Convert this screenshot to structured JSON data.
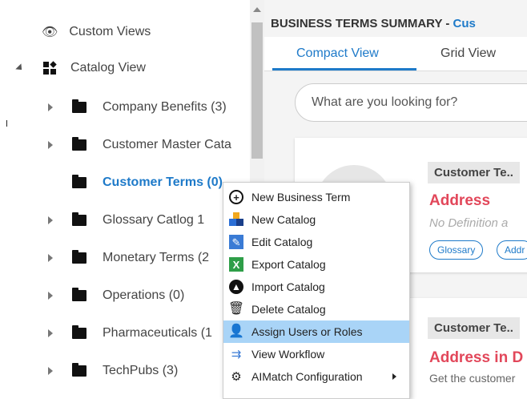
{
  "tree": {
    "custom_views": "Custom Views",
    "catalog_view": "Catalog View",
    "items": [
      {
        "label": "Company Benefits (3)",
        "expandable": true
      },
      {
        "label": "Customer Master Cata",
        "expandable": true
      },
      {
        "label": "Customer Terms (0)",
        "expandable": false,
        "selected": true
      },
      {
        "label": "Glossary Catlog 1",
        "expandable": true
      },
      {
        "label": "Monetary Terms (2",
        "expandable": true
      },
      {
        "label": "Operations (0)",
        "expandable": true
      },
      {
        "label": "Pharmaceuticals (1",
        "expandable": true
      },
      {
        "label": "TechPubs (3)",
        "expandable": true
      }
    ]
  },
  "summary": {
    "title_prefix": "BUSINESS TERMS SUMMARY - ",
    "title_highlight": "Cus",
    "tabs": [
      "Compact View",
      "Grid View"
    ],
    "search_placeholder": "What are you looking for?"
  },
  "cards": [
    {
      "tag": "Customer Te..",
      "title": "Address",
      "desc": "No Definition a",
      "pills": [
        "Glossary",
        "Addr"
      ]
    },
    {
      "tag": "Customer Te..",
      "title": "Address in D",
      "desc": "Get the customer"
    }
  ],
  "context_menu": {
    "items": [
      {
        "label": "New Business Term",
        "icon": "plus-circle-icon"
      },
      {
        "label": "New Catalog",
        "icon": "new-catalog-icon"
      },
      {
        "label": "Edit Catalog",
        "icon": "edit-icon"
      },
      {
        "label": "Export Catalog",
        "icon": "export-icon"
      },
      {
        "label": "Import Catalog",
        "icon": "import-icon"
      },
      {
        "label": "Delete Catalog",
        "icon": "trash-icon"
      },
      {
        "label": "Assign Users or Roles",
        "icon": "user-assign-icon",
        "hover": true
      },
      {
        "label": "View Workflow",
        "icon": "workflow-icon"
      },
      {
        "label": "AIMatch Configuration",
        "icon": "aimatch-icon",
        "submenu": true
      }
    ]
  },
  "colors": {
    "accent": "#1e7ac9",
    "title_red": "#e2475a",
    "menu_hover": "#a9d4f7"
  }
}
